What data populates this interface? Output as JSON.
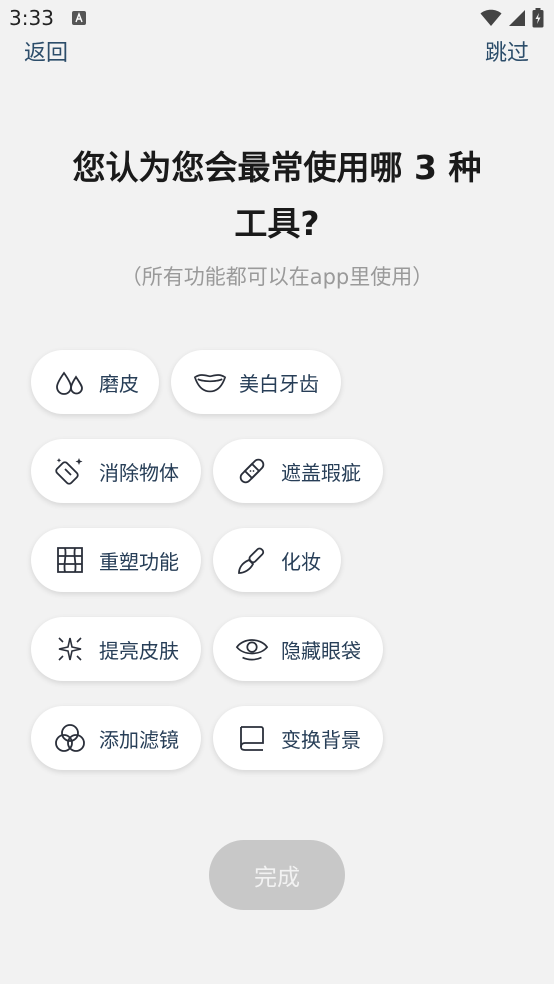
{
  "status": {
    "time": "3:33"
  },
  "nav": {
    "back": "返回",
    "skip": "跳过"
  },
  "heading": {
    "line1": "您认为您会最常使用哪 3 种",
    "line2": "工具?",
    "subtitle": "（所有功能都可以在app里使用）"
  },
  "tools": [
    {
      "label": "磨皮",
      "icon": "drops-icon"
    },
    {
      "label": "美白牙齿",
      "icon": "lips-icon"
    },
    {
      "label": "消除物体",
      "icon": "eraser-icon"
    },
    {
      "label": "遮盖瑕疵",
      "icon": "bandage-icon"
    },
    {
      "label": "重塑功能",
      "icon": "reshape-grid-icon"
    },
    {
      "label": "化妆",
      "icon": "makeup-brush-icon"
    },
    {
      "label": "提亮皮肤",
      "icon": "sparkle-icon"
    },
    {
      "label": "隐藏眼袋",
      "icon": "eye-icon"
    },
    {
      "label": "添加滤镜",
      "icon": "filter-circles-icon"
    },
    {
      "label": "变换背景",
      "icon": "background-icon"
    }
  ],
  "done_label": "完成",
  "colors": {
    "background": "#f2f2f2",
    "accent_text": "#2c4d6a",
    "disabled_button": "#c8c8c8"
  }
}
